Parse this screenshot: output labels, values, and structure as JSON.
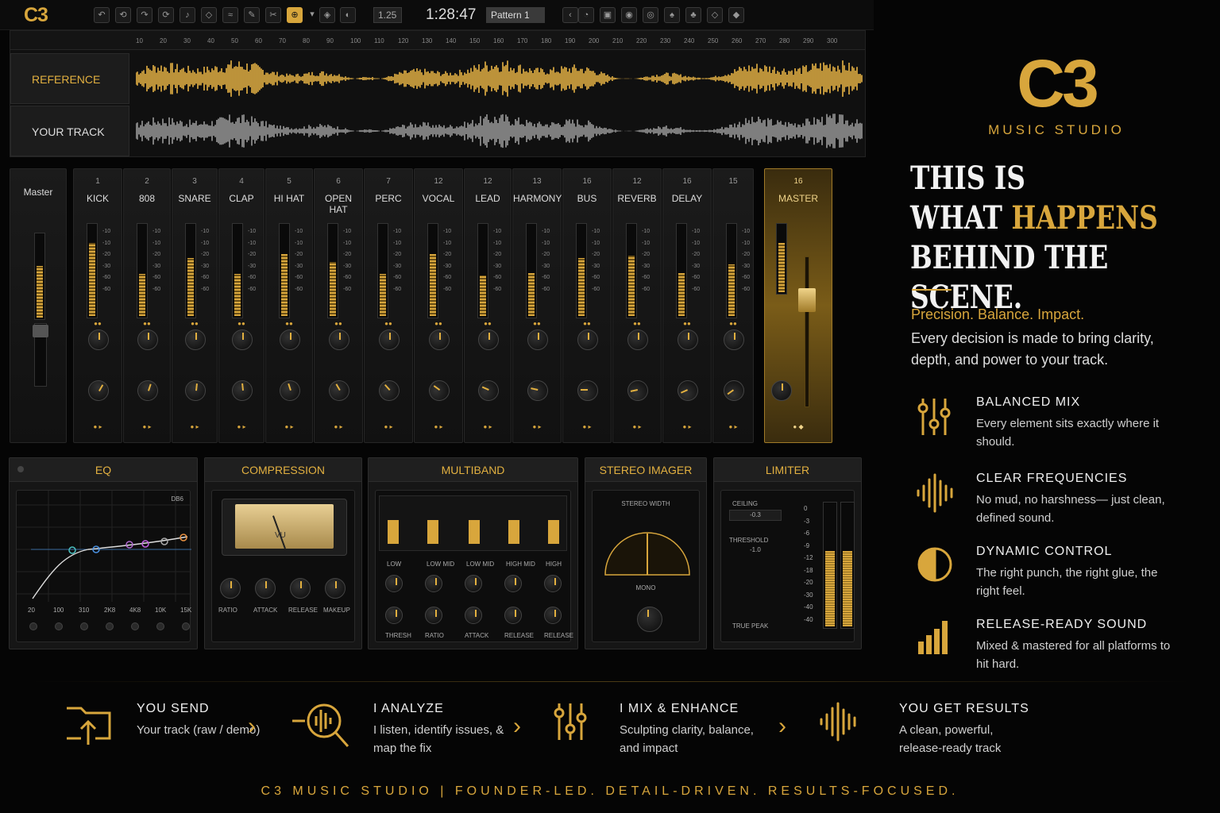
{
  "toolbar": {
    "logo": "C3",
    "zoom": "1.25",
    "time": "1:28:47",
    "pattern": "Pattern 1"
  },
  "arrange": {
    "ruler": [
      "10",
      "20",
      "30",
      "40",
      "50",
      "60",
      "70",
      "80",
      "90",
      "100",
      "110",
      "120",
      "130",
      "140",
      "150",
      "160",
      "170",
      "180",
      "190",
      "200",
      "210",
      "220",
      "230",
      "240",
      "250",
      "260",
      "270",
      "280",
      "290",
      "300"
    ],
    "tracks": [
      {
        "label": "REFERENCE",
        "color": "#e8b445"
      },
      {
        "label": "YOUR TRACK",
        "color": "#9a9a9a"
      }
    ]
  },
  "mixer": {
    "master_left": "Master",
    "scale": [
      "-10",
      "-10",
      "-20",
      "-30",
      "-60",
      "-60"
    ],
    "channels": [
      {
        "num": "1",
        "name": "KICK",
        "level": 0.78
      },
      {
        "num": "2",
        "name": "808",
        "level": 0.45
      },
      {
        "num": "3",
        "name": "SNARE",
        "level": 0.62
      },
      {
        "num": "4",
        "name": "CLAP",
        "level": 0.45
      },
      {
        "num": "5",
        "name": "HI HAT",
        "level": 0.66
      },
      {
        "num": "6",
        "name": "OPEN HAT",
        "level": 0.58
      },
      {
        "num": "7",
        "name": "PERC",
        "level": 0.45
      },
      {
        "num": "12",
        "name": "VOCAL",
        "level": 0.66
      },
      {
        "num": "12",
        "name": "LEAD",
        "level": 0.43
      },
      {
        "num": "13",
        "name": "HARMONY",
        "level": 0.46
      },
      {
        "num": "16",
        "name": "BUS",
        "level": 0.62
      },
      {
        "num": "12",
        "name": "REVERB",
        "level": 0.64
      },
      {
        "num": "16",
        "name": "DELAY",
        "level": 0.46
      },
      {
        "num": "15",
        "name": "",
        "level": 0.55
      }
    ],
    "master": {
      "num": "16",
      "name": "MASTER",
      "level": 0.7
    }
  },
  "plugins": {
    "eq": {
      "title": "EQ",
      "bands": [
        "20",
        "100",
        "310",
        "2K8",
        "4K8",
        "10K",
        "15K"
      ],
      "tag": "DB6"
    },
    "compression": {
      "title": "COMPRESSION",
      "knobs": [
        "RATIO",
        "ATTACK",
        "RELEASE",
        "MAKEUP"
      ],
      "vu": "VU"
    },
    "multiband": {
      "title": "MULTIBAND",
      "bands": [
        "LOW",
        "LOW MID",
        "LOW MID",
        "HIGH MID",
        "HIGH"
      ],
      "knobs": [
        "THRESH",
        "RATIO",
        "ATTACK",
        "RELEASE",
        "RELEASE"
      ]
    },
    "imager": {
      "title": "STEREO IMAGER",
      "width_label": "STEREO WIDTH",
      "mono": "MONO"
    },
    "limiter": {
      "title": "LIMITER",
      "ceiling": "CEILING",
      "ceiling_val": "-0.3",
      "threshold": "THRESHOLD",
      "threshold_val": "-1.0",
      "true_peak": "TRUE PEAK",
      "scale": [
        "0",
        "-3",
        "-6",
        "-9",
        "-12",
        "-18",
        "-20",
        "-30",
        "-40",
        "-40"
      ]
    }
  },
  "brand": {
    "logo": "C3",
    "subtitle": "MUSIC STUDIO",
    "headline_1": "THIS IS",
    "headline_2a": "WHAT ",
    "headline_2b": "HAPPENS",
    "headline_3": "BEHIND THE SCENE.",
    "tagline": "Precision. Balance. Impact.",
    "paragraph": "Every decision is made to bring clarity, depth, and power to your track.",
    "accent": "#d8a63c"
  },
  "features": [
    {
      "icon": "sliders-icon",
      "title": "BALANCED MIX",
      "desc": "Every element sits exactly where it should."
    },
    {
      "icon": "waveform-icon",
      "title": "CLEAR FREQUENCIES",
      "desc": "No mud, no harshness— just clean, defined sound."
    },
    {
      "icon": "dynamics-icon",
      "title": "DYNAMIC CONTROL",
      "desc": "The right punch, the right glue, the right feel."
    },
    {
      "icon": "bars-icon",
      "title": "RELEASE-READY SOUND",
      "desc": "Mixed & mastered for all platforms to hit hard."
    }
  ],
  "steps": [
    {
      "icon": "folder-upload-icon",
      "title": "YOU SEND",
      "desc": "Your track (raw / demo)"
    },
    {
      "icon": "magnifier-wave-icon",
      "title": "I ANALYZE",
      "desc": "I listen, identify issues, & map the fix"
    },
    {
      "icon": "sliders-icon",
      "title": "I MIX & ENHANCE",
      "desc": "Sculpting clarity, balance, and impact"
    },
    {
      "icon": "waveform-icon",
      "title": "YOU GET RESULTS",
      "desc": "A clean, powerful, release-ready track"
    }
  ],
  "footer": "C3 MUSIC STUDIO   |   FOUNDER-LED. DETAIL-DRIVEN. RESULTS-FOCUSED."
}
